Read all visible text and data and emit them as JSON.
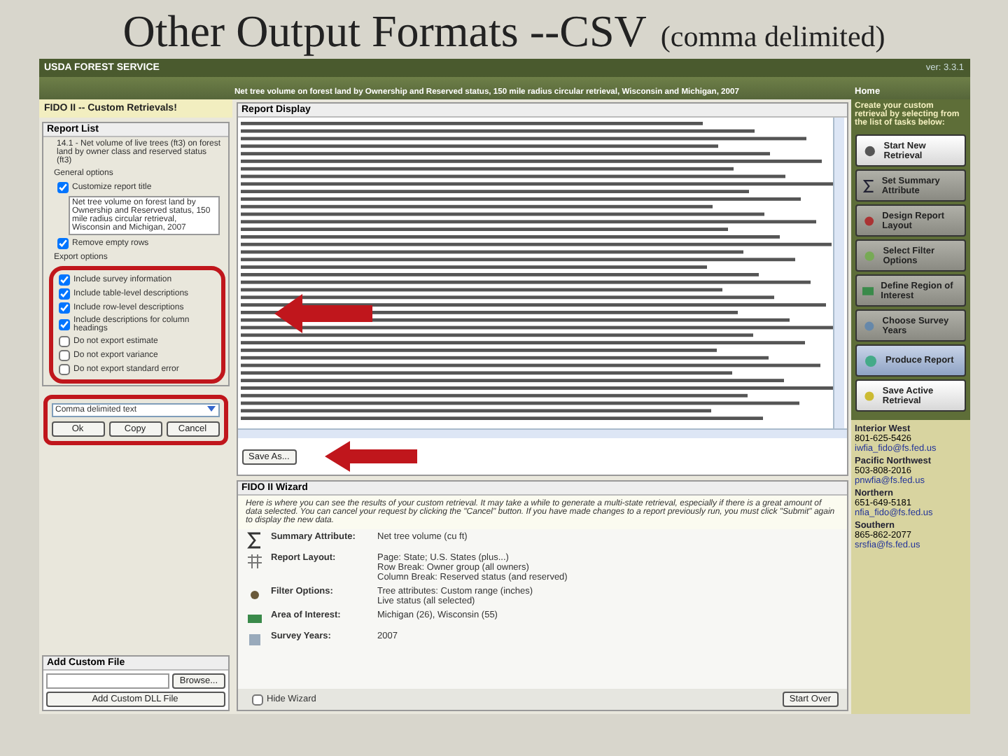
{
  "slide_title": {
    "main": "Other Output Formats --CSV",
    "sub": "(comma delimited)"
  },
  "header": {
    "brand": "USDA FOREST SERVICE",
    "version": "ver: 3.3.1"
  },
  "banner": {
    "text": "Net tree volume on forest land by Ownership and Reserved status, 150 mile radius circular retrieval, Wisconsin and Michigan, 2007",
    "home": "Home"
  },
  "left": {
    "title": "FIDO II -- Custom Retrievals!",
    "report_list": "Report List",
    "report_item": "14.1 - Net volume of live trees (ft3) on forest land by owner class and reserved status (ft3)",
    "general_heading": "General options",
    "general": [
      {
        "label": "Customize report title",
        "checked": true
      }
    ],
    "title_text": "Net tree volume on forest land by Ownership and Reserved status, 150 mile radius circular retrieval, Wisconsin and Michigan, 2007",
    "general_after": [
      {
        "label": "Remove empty rows",
        "checked": true
      }
    ],
    "export_heading": "Export options",
    "export": [
      {
        "label": "Include survey information",
        "checked": true
      },
      {
        "label": "Include table-level descriptions",
        "checked": true
      },
      {
        "label": "Include row-level descriptions",
        "checked": true
      },
      {
        "label": "Include descriptions for column headings",
        "checked": true
      },
      {
        "label": "Do not export estimate",
        "checked": false
      },
      {
        "label": "Do not export variance",
        "checked": false
      },
      {
        "label": "Do not export standard error",
        "checked": false
      }
    ],
    "format": "Comma delimited text",
    "buttons": [
      "Ok",
      "Copy",
      "Cancel"
    ],
    "custom_file": {
      "heading": "Add Custom File",
      "browse": "Browse...",
      "add": "Add Custom DLL File"
    }
  },
  "report_display": {
    "heading": "Report Display",
    "save_as": "Save As..."
  },
  "wizard": {
    "heading": "FIDO II Wizard",
    "intro": "Here is where you can see the results of your custom retrieval. It may take a while to generate a multi-state retrieval, especially if there is a great amount of data selected. You can cancel your request by clicking the \"Cancel\" button. If you have made changes to a report previously run, you must click \"Submit\" again to display the new data.",
    "steps": [
      {
        "label": "Summary Attribute:",
        "value": "Net tree volume (cu ft)"
      },
      {
        "label": "Report Layout:",
        "value": "Page: State; U.S. States (plus...)\nRow Break: Owner group (all owners)\nColumn Break: Reserved status (and reserved)"
      },
      {
        "label": "Filter Options:",
        "value": "Tree attributes: Custom range (inches)\nLive status (all selected)"
      },
      {
        "label": "Area of Interest:",
        "value": "Michigan (26), Wisconsin (55)"
      },
      {
        "label": "Survey Years:",
        "value": "2007"
      }
    ],
    "hide": {
      "label": "Hide Wizard",
      "checked": false
    },
    "start_over": "Start Over"
  },
  "nav": {
    "intro": "Create your custom retrieval by selecting from the list of tasks below:",
    "items": [
      {
        "label": "Start New Retrieval",
        "kind": "plain"
      },
      {
        "label": "Set Summary Attribute",
        "kind": "step"
      },
      {
        "label": "Design Report Layout",
        "kind": "step"
      },
      {
        "label": "Select Filter Options",
        "kind": "step"
      },
      {
        "label": "Define Region of Interest",
        "kind": "step"
      },
      {
        "label": "Choose Survey Years",
        "kind": "step"
      },
      {
        "label": "Produce Report",
        "kind": "current"
      },
      {
        "label": "Save Active Retrieval",
        "kind": "plain"
      }
    ]
  },
  "contacts": [
    {
      "region": "Interior West",
      "phone": "801-625-5426",
      "email": "iwfia_fido@fs.fed.us"
    },
    {
      "region": "Pacific Northwest",
      "phone": "503-808-2016",
      "email": "pnwfia@fs.fed.us"
    },
    {
      "region": "Northern",
      "phone": "651-649-5181",
      "email": "nfia_fido@fs.fed.us"
    },
    {
      "region": "Southern",
      "phone": "865-862-2077",
      "email": "srsfia@fs.fed.us"
    }
  ]
}
